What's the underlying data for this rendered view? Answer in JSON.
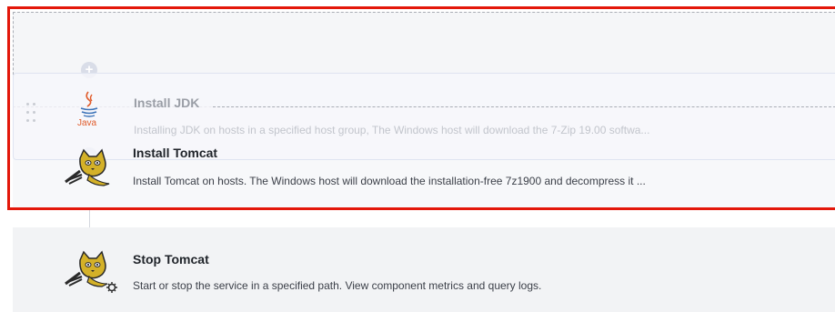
{
  "steps": [
    {
      "title": "Install JDK",
      "description": "Installing JDK on hosts in a specified host group, The Windows host will download the 7-Zip 19.00 softwa...",
      "icon": "java-icon",
      "icon_caption": "Java",
      "state": "dragging"
    },
    {
      "title": "Install Tomcat",
      "description": "Install Tomcat on hosts. The Windows host will download the installation-free 7z1900 and decompress it ...",
      "icon": "tomcat-icon",
      "state": "highlighted"
    },
    {
      "title": "Stop Tomcat",
      "description": "Start or stop the service in a specified path. View component metrics and query logs.",
      "icon": "tomcat-gear-icon",
      "state": "normal"
    }
  ],
  "colors": {
    "highlight": "#e3170a",
    "connector": "#d9dde8",
    "card_bg": "#f7f8fa"
  }
}
